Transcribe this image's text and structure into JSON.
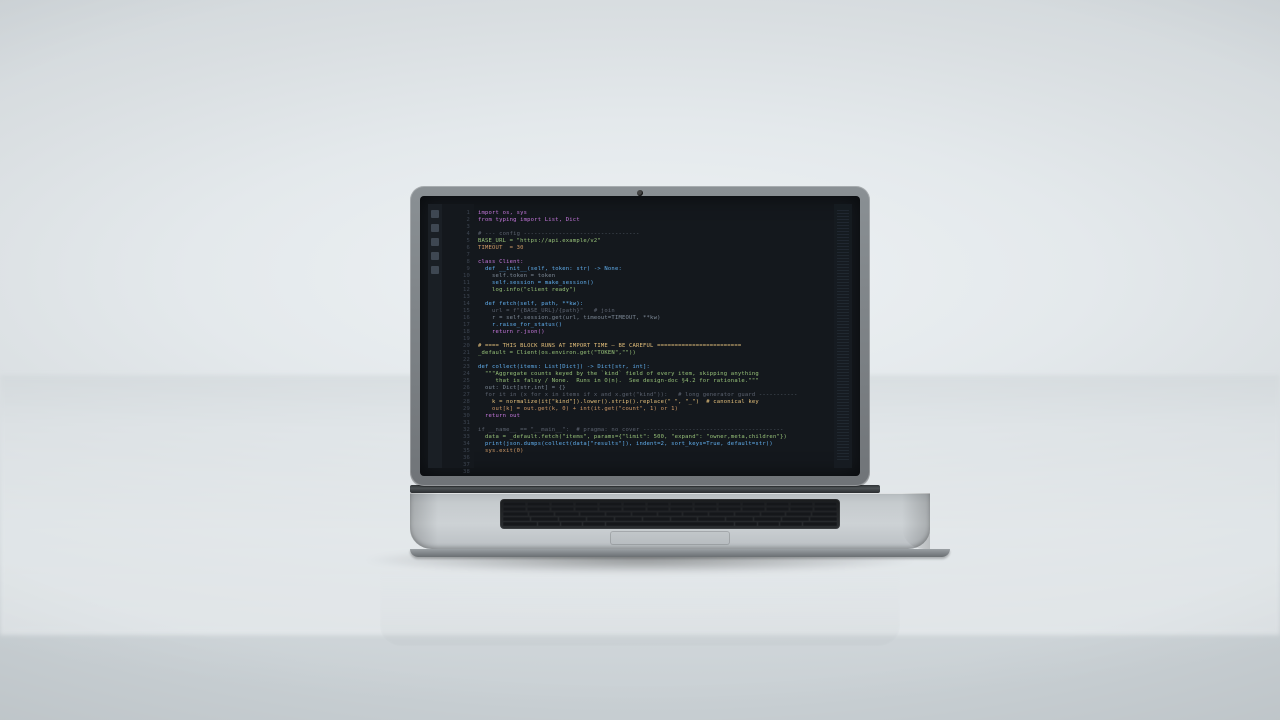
{
  "scene": {
    "subject": "laptop",
    "screen_content": "code-editor"
  },
  "editor": {
    "line_count": 38,
    "lines": [
      {
        "i": 0,
        "t": "import os, sys",
        "c": "kw"
      },
      {
        "i": 0,
        "t": "from typing import List, Dict",
        "c": "kw"
      },
      {
        "i": 0,
        "t": "",
        "c": ""
      },
      {
        "i": 0,
        "t": "# --- config ---------------------------------",
        "c": "com"
      },
      {
        "i": 0,
        "t": "BASE_URL = \"https://api.example/v2\"",
        "c": "str"
      },
      {
        "i": 0,
        "t": "TIMEOUT  = 30",
        "c": "num"
      },
      {
        "i": 0,
        "t": "",
        "c": ""
      },
      {
        "i": 0,
        "t": "class Client:",
        "c": "kw"
      },
      {
        "i": 1,
        "t": "def __init__(self, token: str) -> None:",
        "c": "fn"
      },
      {
        "i": 2,
        "t": "self.token = token",
        "c": ""
      },
      {
        "i": 2,
        "t": "self.session = make_session()",
        "c": "fn"
      },
      {
        "i": 2,
        "t": "log.info(\"client ready\")",
        "c": "str"
      },
      {
        "i": 0,
        "t": "",
        "c": ""
      },
      {
        "i": 1,
        "t": "def fetch(self, path, **kw):",
        "c": "fn"
      },
      {
        "i": 2,
        "t": "url = f\"{BASE_URL}/{path}\"   # join",
        "c": "com"
      },
      {
        "i": 2,
        "t": "r = self.session.get(url, timeout=TIMEOUT, **kw)",
        "c": ""
      },
      {
        "i": 2,
        "t": "r.raise_for_status()",
        "c": "fn"
      },
      {
        "i": 2,
        "t": "return r.json()",
        "c": "kw"
      },
      {
        "i": 0,
        "t": "",
        "c": ""
      },
      {
        "i": 0,
        "t": "# ==== THIS BLOCK RUNS AT IMPORT TIME — BE CAREFUL ========================",
        "c": "t-yel"
      },
      {
        "i": 0,
        "t": "_default = Client(os.environ.get(\"TOKEN\",\"\"))",
        "c": "str"
      },
      {
        "i": 0,
        "t": "",
        "c": ""
      },
      {
        "i": 0,
        "t": "def collect(items: List[Dict]) -> Dict[str, int]:",
        "c": "fn"
      },
      {
        "i": 1,
        "t": "\"\"\"Aggregate counts keyed by the `kind` field of every item, skipping anything",
        "c": "str"
      },
      {
        "i": 1,
        "t": "   that is falsy / None.  Runs in O(n).  See design-doc §4.2 for rationale.\"\"\"",
        "c": "str"
      },
      {
        "i": 1,
        "t": "out: Dict[str,int] = {}",
        "c": ""
      },
      {
        "i": 1,
        "t": "for it in (x for x in items if x and x.get(\"kind\")):   # long generator guard -----------",
        "c": "com"
      },
      {
        "i": 2,
        "t": "k = normalize(it[\"kind\"]).lower().strip().replace(\" \", \"_\")  # canonical key",
        "c": "t-yel"
      },
      {
        "i": 2,
        "t": "out[k] = out.get(k, 0) + int(it.get(\"count\", 1) or 1)",
        "c": "num"
      },
      {
        "i": 1,
        "t": "return out",
        "c": "kw"
      },
      {
        "i": 0,
        "t": "",
        "c": ""
      },
      {
        "i": 0,
        "t": "if __name__ == \"__main__\":  # pragma: no cover ----------------------------------------",
        "c": "com"
      },
      {
        "i": 1,
        "t": "data = _default.fetch(\"items\", params={\"limit\": 500, \"expand\": \"owner,meta,children\"})",
        "c": "str"
      },
      {
        "i": 1,
        "t": "print(json.dumps(collect(data[\"results\"]), indent=2, sort_keys=True, default=str))",
        "c": "fn"
      },
      {
        "i": 1,
        "t": "sys.exit(0)",
        "c": "num"
      },
      {
        "i": 0,
        "t": "",
        "c": ""
      },
      {
        "i": 0,
        "t": "",
        "c": ""
      },
      {
        "i": 0,
        "t": "",
        "c": ""
      }
    ]
  }
}
